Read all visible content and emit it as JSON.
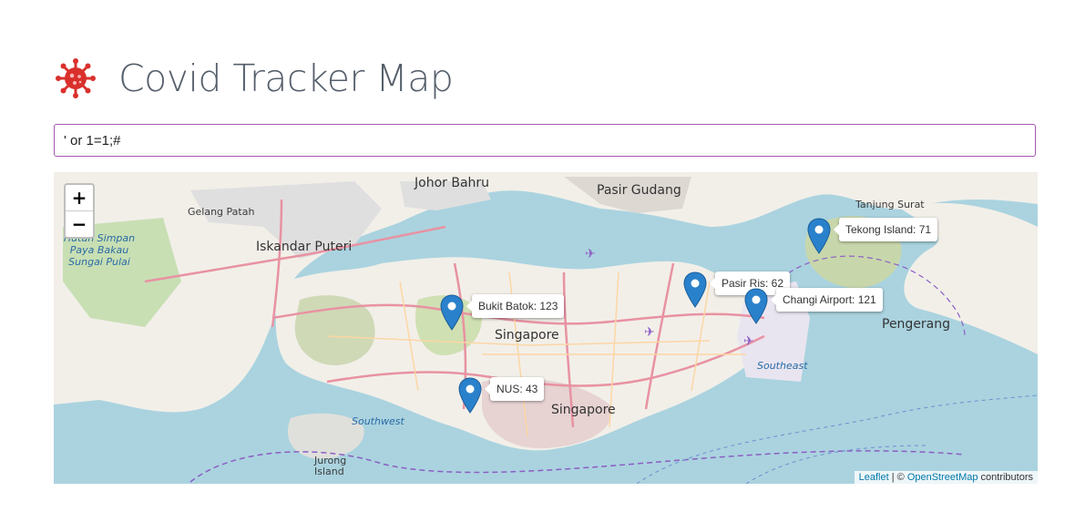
{
  "header": {
    "title": "Covid Tracker Map",
    "icon": "virus-icon"
  },
  "search": {
    "value": "' or 1=1;#"
  },
  "map": {
    "zoom_in": "+",
    "zoom_out": "−",
    "places": {
      "johor_bahru": "Johor Bahru",
      "pasir_gudang": "Pasir Gudang",
      "tanjung_surat": "Tanjung Surat",
      "gelang_patah": "Gelang Patah",
      "iskandar_puteri": "Iskandar Puteri",
      "singapore_mid": "Singapore",
      "singapore_south": "Singapore",
      "pengerang": "Pengerang",
      "southeast": "Southeast",
      "southwest": "Southwest",
      "jurong_island": "Jurong Island",
      "hutan": "Hutan Simpan Paya Bakau Sungai Pulai"
    },
    "markers": [
      {
        "label": "Bukit Batok: 123"
      },
      {
        "label": "NUS: 43"
      },
      {
        "label": "Pasir Ris: 62"
      },
      {
        "label": "Changi Airport: 121"
      },
      {
        "label": "Tekong Island: 71"
      }
    ],
    "attribution": {
      "leaflet": "Leaflet",
      "sep": " | © ",
      "osm": "OpenStreetMap",
      "contributors": " contributors"
    }
  }
}
